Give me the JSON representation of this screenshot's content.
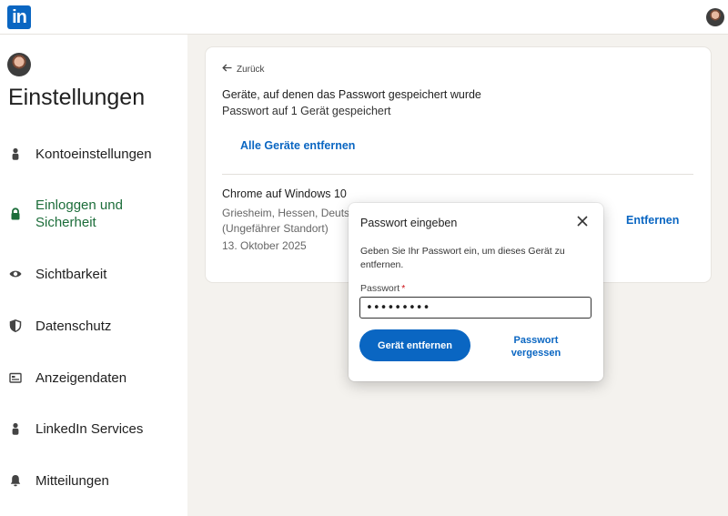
{
  "header": {
    "logo_text": "in",
    "logo_color": "#0a66c2"
  },
  "sidebar": {
    "title": "Einstellungen",
    "items": [
      {
        "label": "Kontoeinstellungen",
        "icon": "person-icon",
        "active": false
      },
      {
        "label": "Einloggen und Sicherheit",
        "icon": "lock-icon",
        "active": true
      },
      {
        "label": "Sichtbarkeit",
        "icon": "eye-icon",
        "active": false
      },
      {
        "label": "Datenschutz",
        "icon": "shield-icon",
        "active": false
      },
      {
        "label": "Anzeigendaten",
        "icon": "ad-icon",
        "active": false
      },
      {
        "label": "LinkedIn Services",
        "icon": "person-icon",
        "active": false
      },
      {
        "label": "Mitteilungen",
        "icon": "bell-icon",
        "active": false
      }
    ],
    "active_color": "#1c6d3a"
  },
  "main": {
    "back_label": "Zurück",
    "title": "Geräte, auf denen das Passwort gespeichert wurde",
    "subtitle": "Passwort auf 1 Gerät gespeichert",
    "remove_all_label": "Alle Geräte entfernen",
    "device": {
      "name": "Chrome auf Windows 10",
      "location": "Griesheim, Hessen, Deutschland",
      "location_note": "(Ungefährer Standort)",
      "date": "13. Oktober 2025",
      "remove_label": "Entfernen"
    }
  },
  "modal": {
    "title": "Passwort eingeben",
    "description": "Geben Sie Ihr Passwort ein, um dieses Gerät zu entfernen.",
    "field_label": "Passwort",
    "required_mark": "*",
    "password_value": "•••••••••",
    "primary_label": "Gerät entfernen",
    "forgot_label": "Passwort vergessen",
    "accent_color": "#0a66c2"
  }
}
